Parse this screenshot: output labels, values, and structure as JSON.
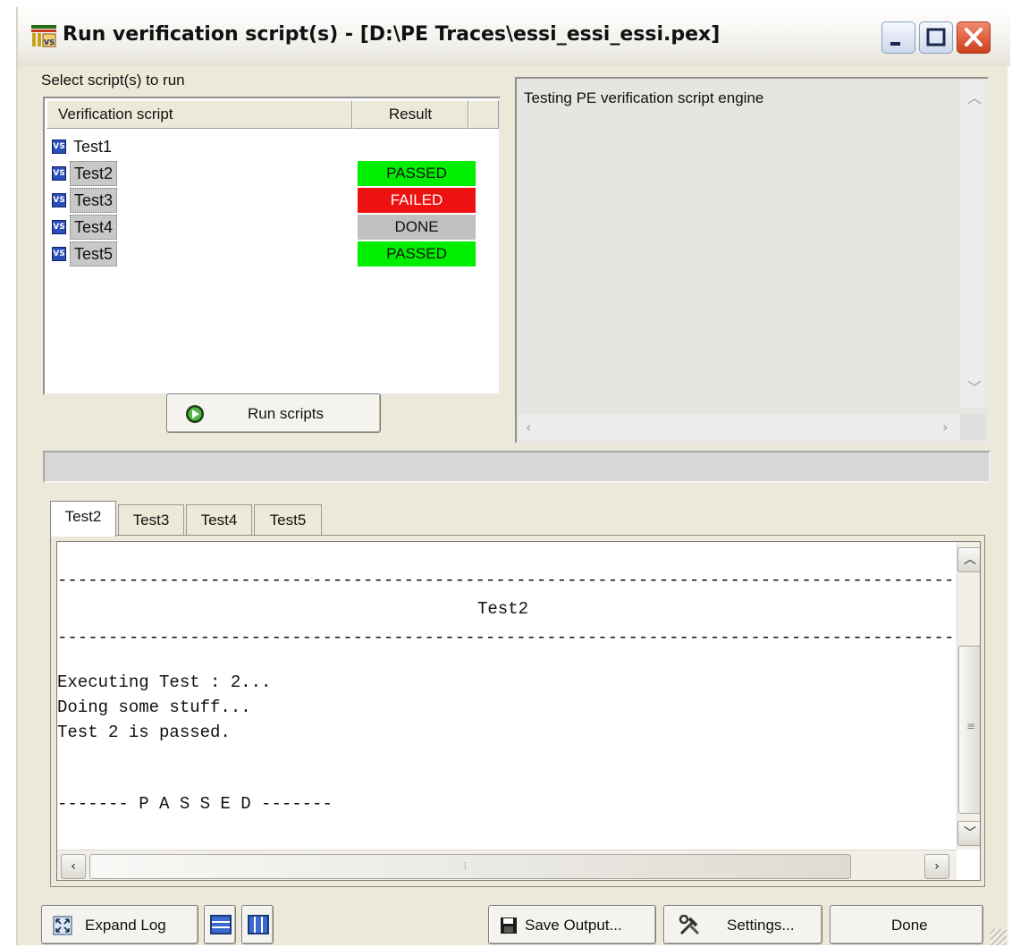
{
  "window": {
    "title": "Run verification script(s) - [D:\\PE Traces\\essi_essi_essi.pex]"
  },
  "scripts_panel": {
    "label": "Select script(s) to run",
    "columns": [
      "Verification script",
      "Result"
    ],
    "rows": [
      {
        "name": "Test1",
        "result": "",
        "result_color": "",
        "selected": false
      },
      {
        "name": "Test2",
        "result": "PASSED",
        "result_color": "#00ee00",
        "selected": true
      },
      {
        "name": "Test3",
        "result": "FAILED",
        "result_color": "#ee1111",
        "selected": true
      },
      {
        "name": "Test4",
        "result": "DONE",
        "result_color": "#c0c0c0",
        "selected": true
      },
      {
        "name": "Test5",
        "result": "PASSED",
        "result_color": "#00ee00",
        "selected": true
      }
    ],
    "run_button": "Run scripts"
  },
  "output_pane": {
    "text": "Testing PE verification script engine"
  },
  "progress": 0,
  "tabs": [
    "Test2",
    "Test3",
    "Test4",
    "Test5"
  ],
  "active_tab": "Test2",
  "log": {
    "separator": "------------------------------------------------------------------------------------------------------------------------",
    "heading": "Test2",
    "lines": [
      "Executing Test : 2...",
      "Doing some stuff...",
      "Test 2 is passed."
    ],
    "footer": "------- P A S S E D -------"
  },
  "buttons": {
    "expand_log": "Expand Log",
    "save_output": "Save Output...",
    "settings": "Settings...",
    "done": "Done"
  },
  "icons": [
    "app-icon",
    "vs-script-icon",
    "run-icon",
    "expand-icon",
    "horizontal-split-icon",
    "vertical-split-icon",
    "floppy-disk-icon",
    "tools-icon"
  ]
}
